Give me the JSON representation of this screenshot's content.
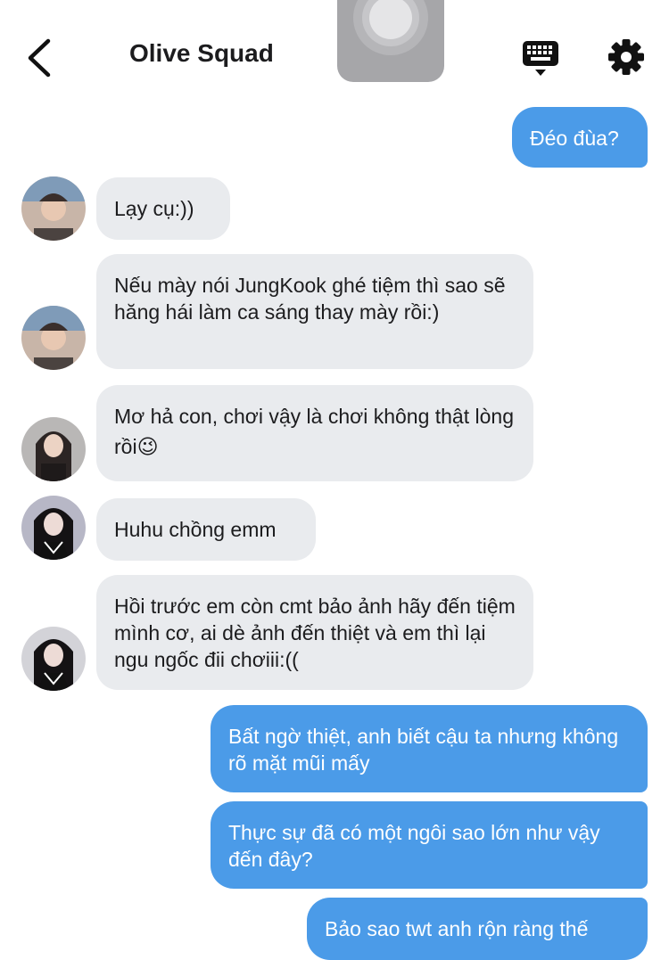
{
  "header": {
    "back_icon": "chevron-left-icon",
    "title": "Olive Squad",
    "keyboard_icon": "keyboard-icon",
    "settings_icon": "gear-icon"
  },
  "colors": {
    "outgoing_bubble": "#4b9be8",
    "incoming_bubble": "#e9ebee",
    "text": "#1c1c1e"
  },
  "messages": [
    {
      "dir": "out",
      "text": "Đéo đùa?"
    },
    {
      "dir": "in",
      "text": "Lạy cụ:))"
    },
    {
      "dir": "in",
      "text": "Nếu mày nói JungKook ghé tiệm thì sao sẽ hăng hái làm ca sáng thay mày rồi:)"
    },
    {
      "dir": "in",
      "text": "Mơ hả con, chơi vậy là chơi không thật lòng rồi",
      "emoji": "😉"
    },
    {
      "dir": "in",
      "text": "Huhu chồng emm"
    },
    {
      "dir": "in",
      "text": "Hồi trước em còn cmt bảo ảnh hãy đến tiệm mình cơ, ai dè ảnh đến thiệt và em thì lại ngu ngốc đii chơiii:(("
    },
    {
      "dir": "out",
      "text": "Bất ngờ thiệt, anh biết cậu ta nhưng không rõ mặt mũi mấy"
    },
    {
      "dir": "out",
      "text": "Thực sự đã có một ngôi sao lớn như vậy đến đây?"
    },
    {
      "dir": "out",
      "text": "Bảo sao twt anh rộn ràng thế"
    }
  ]
}
